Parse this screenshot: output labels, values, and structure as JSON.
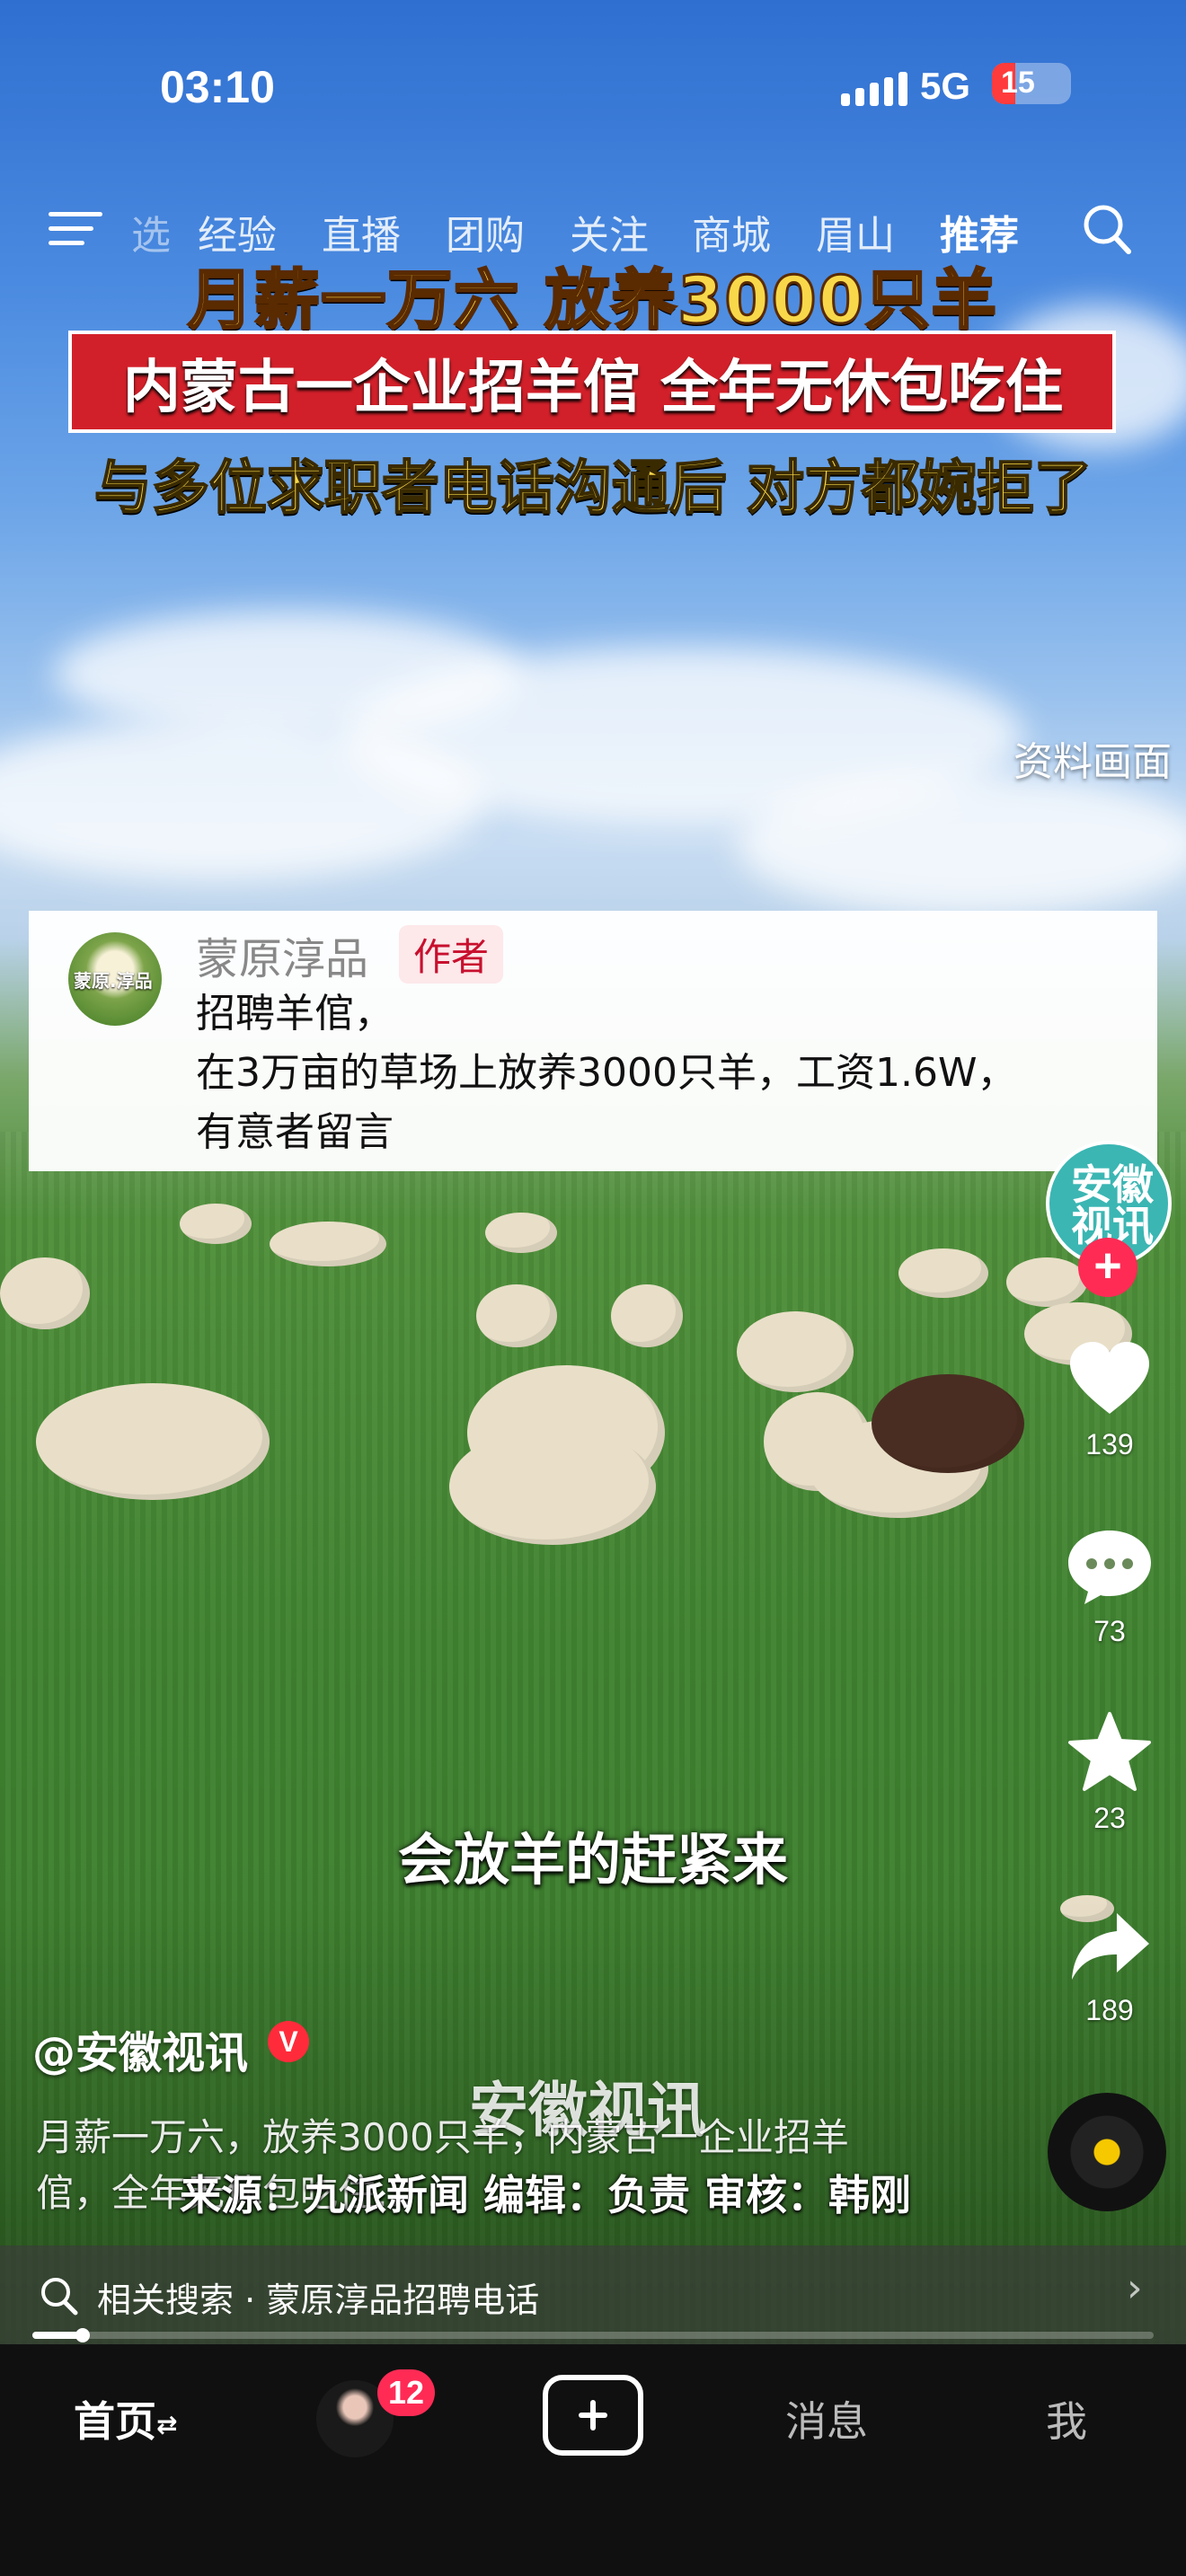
{
  "status_bar": {
    "time": "03:10",
    "network": "5G",
    "battery": "15"
  },
  "top_nav": {
    "tabs": [
      {
        "label": "选"
      },
      {
        "label": "经验"
      },
      {
        "label": "直播"
      },
      {
        "label": "团购"
      },
      {
        "label": "关注"
      },
      {
        "label": "商城"
      },
      {
        "label": "眉山"
      },
      {
        "label": "推荐"
      }
    ],
    "active_tab": "推荐"
  },
  "video": {
    "headline_1": "月薪一万六 放养3000只羊",
    "headline_2": "内蒙古一企业招羊倌 全年无休包吃住",
    "headline_3": "与多位求职者电话沟通后 对方都婉拒了",
    "side_note": "资料画面",
    "subtitle": "会放羊的赶紧来",
    "watermark": "安徽视讯",
    "credit": "来源：九派新闻 编辑：负责 审核：韩刚"
  },
  "pinned_comment": {
    "avatar_text": "蒙原.淳品",
    "name": "蒙原淳品",
    "badge": "作者",
    "lines": [
      "招聘羊倌，",
      "在3万亩的草场上放养3000只羊，工资1.6W，",
      "有意者留言"
    ]
  },
  "actions": {
    "creator_avatar_text": "安徽视讯",
    "like_count": "139",
    "comment_count": "73",
    "favorite_count": "23",
    "share_count": "189"
  },
  "post": {
    "author": "@安徽视讯",
    "verified": "V",
    "desc_line_1": "月薪一万六，放养3000只羊，内蒙古一企业招羊",
    "desc_line_2": "倌，全年无休包吃住……"
  },
  "related_search": {
    "prefix": "相关搜索",
    "query": "蒙原淳品招聘电话",
    "separator": "·"
  },
  "progress": {
    "fraction": 0.045
  },
  "bottom_bar": {
    "home": "首页",
    "home_suffix": "⇄",
    "friends_badge": "12",
    "messages": "消息",
    "me": "我"
  }
}
